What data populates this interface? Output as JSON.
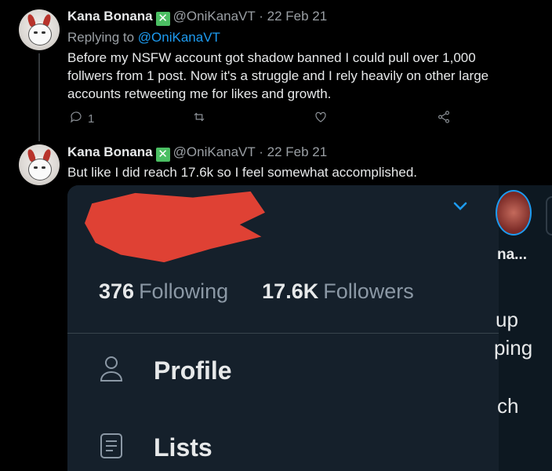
{
  "tweet1": {
    "name": "Kana Bonana",
    "verified_glyph": "✕",
    "handle": "@OniKanaVT",
    "separator": "·",
    "date": "22 Feb 21",
    "replying_prefix": "Replying to",
    "replying_handle": "@OniKanaVT",
    "text_lines": [
      "Before my NSFW account got shadow banned I could pull over 1,000",
      "follwers from 1 post. Now it's a struggle and I rely heavily on other large",
      "accounts retweeting me for likes and growth."
    ],
    "reply_count": "1"
  },
  "tweet2": {
    "name": "Kana Bonana",
    "verified_glyph": "✕",
    "handle": "@OniKanaVT",
    "separator": "·",
    "date": "22 Feb 21",
    "text": "But like I did reach 17.6k so I feel somewhat accomplished."
  },
  "embed": {
    "following_count": "376",
    "following_label": "Following",
    "followers_count": "17.6K",
    "followers_label": "Followers",
    "menu": [
      {
        "label": "Profile",
        "icon": "person-icon"
      },
      {
        "label": "Lists",
        "icon": "list-icon"
      }
    ],
    "right_strip": {
      "name_fragment": "na...",
      "line1": "up",
      "line2": "ping",
      "line3": "ch"
    }
  },
  "colors": {
    "background": "#000000",
    "embed_background": "#15202b",
    "link": "#1d9bf0",
    "muted": "#9a9fa4",
    "verified": "#4bbf63",
    "redaction": "#ea4335"
  }
}
